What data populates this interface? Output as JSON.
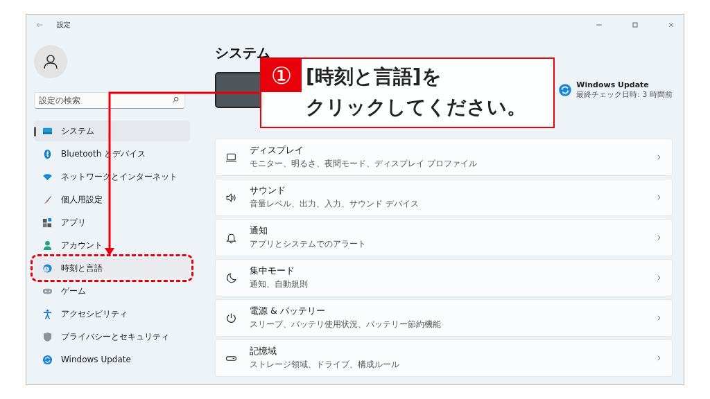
{
  "window": {
    "title": "設定"
  },
  "sidebar": {
    "search": {
      "placeholder": "設定の検索"
    },
    "items": [
      {
        "label": "システム",
        "selected": true,
        "marked": false
      },
      {
        "label": "Bluetooth とデバイス",
        "selected": false,
        "marked": false
      },
      {
        "label": "ネットワークとインターネット",
        "selected": false,
        "marked": false
      },
      {
        "label": "個人用設定",
        "selected": false,
        "marked": false
      },
      {
        "label": "アプリ",
        "selected": false,
        "marked": false
      },
      {
        "label": "アカウント",
        "selected": false,
        "marked": false
      },
      {
        "label": "時刻と言語",
        "selected": false,
        "marked": true
      },
      {
        "label": "ゲーム",
        "selected": false,
        "marked": false
      },
      {
        "label": "アクセシビリティ",
        "selected": false,
        "marked": false
      },
      {
        "label": "プライバシーとセキュリティ",
        "selected": false,
        "marked": false
      },
      {
        "label": "Windows Update",
        "selected": false,
        "marked": false
      }
    ]
  },
  "content": {
    "title": "システム",
    "update": {
      "title": "Windows Update",
      "subtitle": "最終チェック日時: 3 時間前"
    },
    "cards": [
      {
        "title": "ディスプレイ",
        "subtitle": "モニター、明るさ、夜間モード、ディスプレイ プロファイル"
      },
      {
        "title": "サウンド",
        "subtitle": "音量レベル、出力、入力、サウンド デバイス"
      },
      {
        "title": "通知",
        "subtitle": "アプリとシステムでのアラート"
      },
      {
        "title": "集中モード",
        "subtitle": "通知、自動規則"
      },
      {
        "title": "電源 & バッテリー",
        "subtitle": "スリープ、バッテリ使用状況、バッテリー節約機能"
      },
      {
        "title": "記憶域",
        "subtitle": "ストレージ領域、ドライブ、構成ルール"
      }
    ]
  },
  "callout": {
    "number": "①",
    "lines": [
      "[時刻と言語]を",
      "クリックしてください。"
    ]
  }
}
